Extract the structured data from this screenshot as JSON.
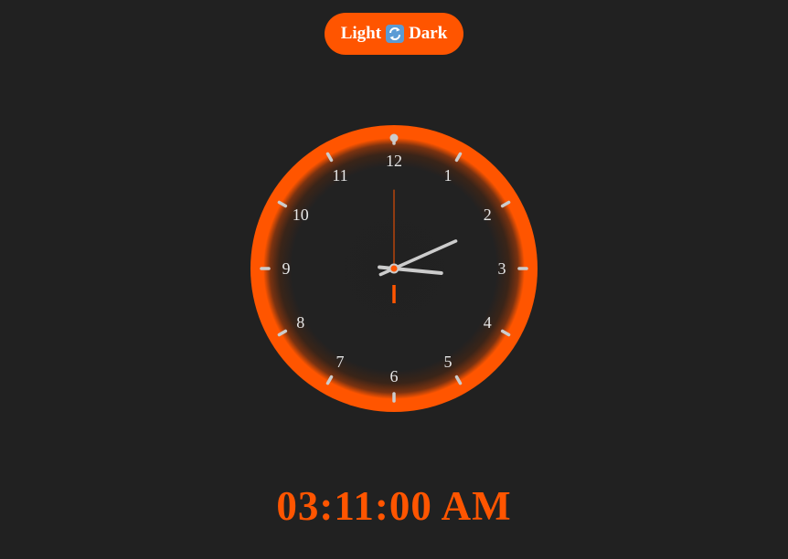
{
  "theme_toggle": {
    "light_label": "Light",
    "icon": "swap-arrows-icon",
    "dark_label": "Dark"
  },
  "clock": {
    "numerals": [
      "12",
      "1",
      "2",
      "3",
      "4",
      "5",
      "6",
      "7",
      "8",
      "9",
      "10",
      "11"
    ],
    "hours": 3,
    "minutes": 11,
    "seconds": 0,
    "accent_color": "#ff5500",
    "hand_color": "#cccccc",
    "face_color": "#212121"
  },
  "digital": {
    "time_text": "03:11:00 AM"
  },
  "colors": {
    "background": "#212121",
    "accent": "#ff5500",
    "text_light": "#e6e6e6"
  }
}
